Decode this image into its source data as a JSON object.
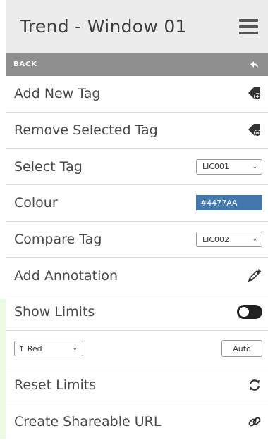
{
  "window": {
    "title": "Trend - Window 01"
  },
  "nav": {
    "back_label": "BACK"
  },
  "menu": {
    "add_tag": "Add New Tag",
    "remove_tag": "Remove Selected Tag",
    "select_tag": {
      "label": "Select Tag",
      "value": "LIC001"
    },
    "colour": {
      "label": "Colour",
      "value": "#4477AA",
      "swatch": "#4477AA"
    },
    "compare_tag": {
      "label": "Compare Tag",
      "value": "LIC002"
    },
    "add_annotation": "Add Annotation",
    "show_limits": {
      "label": "Show Limits",
      "enabled": false
    },
    "limits": {
      "select_value": "↑ Red",
      "input_value": "Auto"
    },
    "reset_limits": "Reset Limits",
    "share_url": "Create Shareable URL"
  },
  "icons": {
    "menu": "hamburger-icon",
    "back": "back-arrow-icon",
    "add_tag": "tag-add-icon",
    "remove_tag": "tag-remove-icon",
    "annotation": "pencil-plus-icon",
    "reset": "sync-icon",
    "share": "link-icon"
  }
}
